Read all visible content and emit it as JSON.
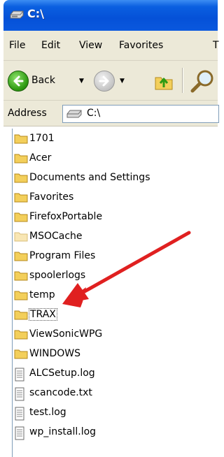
{
  "window": {
    "title": "C:\\"
  },
  "menu": {
    "items": [
      "File",
      "Edit",
      "View",
      "Favorites",
      "T"
    ]
  },
  "toolbar": {
    "back_label": "Back"
  },
  "address": {
    "label": "Address",
    "value": "C:\\"
  },
  "files": [
    {
      "name": "1701",
      "type": "folder"
    },
    {
      "name": "Acer",
      "type": "folder"
    },
    {
      "name": "Documents and Settings",
      "type": "folder"
    },
    {
      "name": "Favorites",
      "type": "folder"
    },
    {
      "name": "FirefoxPortable",
      "type": "folder"
    },
    {
      "name": "MSOCache",
      "type": "folder-hidden"
    },
    {
      "name": "Program Files",
      "type": "folder"
    },
    {
      "name": "spoolerlogs",
      "type": "folder"
    },
    {
      "name": "temp",
      "type": "folder"
    },
    {
      "name": "TRAX",
      "type": "folder",
      "focused": true
    },
    {
      "name": "ViewSonicWPG",
      "type": "folder"
    },
    {
      "name": "WINDOWS",
      "type": "folder"
    },
    {
      "name": "ALCSetup.log",
      "type": "text-file"
    },
    {
      "name": "scancode.txt",
      "type": "text-file"
    },
    {
      "name": "test.log",
      "type": "text-file"
    },
    {
      "name": "wp_install.log",
      "type": "text-file"
    }
  ],
  "annotation": {
    "color": "#e02020",
    "icon": "red-arrow-annotation"
  },
  "colors": {
    "titlebar": "#0a5fe0",
    "chrome": "#ece9d8",
    "folder": "#f3cf5b"
  }
}
